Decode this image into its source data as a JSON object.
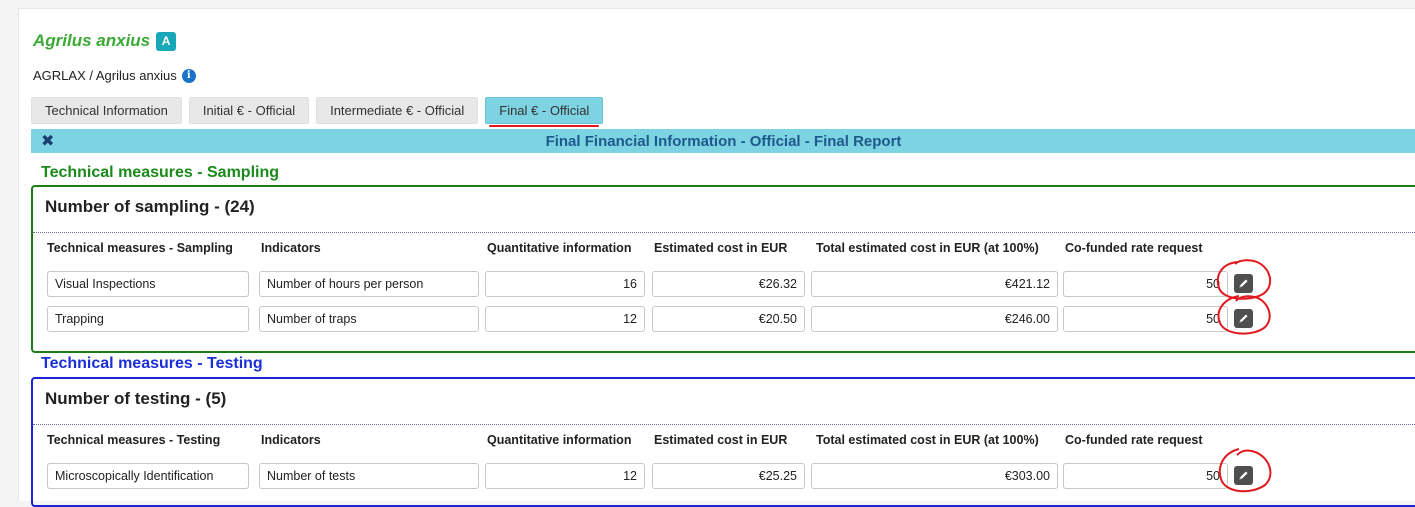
{
  "species": {
    "name": "Agrilus anxius",
    "badge": "A",
    "subtitle": "AGRLAX / Agrilus anxius",
    "info_icon": "info-circle-icon"
  },
  "tabs": [
    {
      "label": "Technical Information",
      "active": false
    },
    {
      "label": "Initial € - Official",
      "active": false
    },
    {
      "label": "Intermediate € - Official",
      "active": false
    },
    {
      "label": "Final € - Official",
      "active": true
    }
  ],
  "section": {
    "title": "Final Financial Information - Official - Final Report",
    "close_icon": "close-icon"
  },
  "sampling": {
    "group_title": "Technical measures - Sampling",
    "heading": "Number of sampling - (24)",
    "columns": [
      "Technical measures - Sampling",
      "Indicators",
      "Quantitative information",
      "Estimated cost in EUR",
      "Total estimated cost in EUR (at 100%)",
      "Co-funded rate request"
    ],
    "rows": [
      {
        "measure": "Visual Inspections",
        "indicator": "Number of hours per person",
        "quantity": "16",
        "cost": "€26.32",
        "total": "€421.12",
        "rate": "50"
      },
      {
        "measure": "Trapping",
        "indicator": "Number of traps",
        "quantity": "12",
        "cost": "€20.50",
        "total": "€246.00",
        "rate": "50"
      }
    ]
  },
  "testing": {
    "group_title": "Technical measures - Testing",
    "heading": "Number of testing - (5)",
    "columns": [
      "Technical measures - Testing",
      "Indicators",
      "Quantitative information",
      "Estimated cost in EUR",
      "Total estimated cost in EUR (at 100%)",
      "Co-funded rate request"
    ],
    "rows": [
      {
        "measure": "Microscopically Identification",
        "indicator": "Number of tests",
        "quantity": "12",
        "cost": "€25.25",
        "total": "€303.00",
        "rate": "50"
      }
    ]
  },
  "colors": {
    "accent_tab": "#7dd3e1",
    "sampling_border": "#1a7d1a",
    "testing_border": "#1b22d8",
    "annotation": "#e0191f"
  }
}
